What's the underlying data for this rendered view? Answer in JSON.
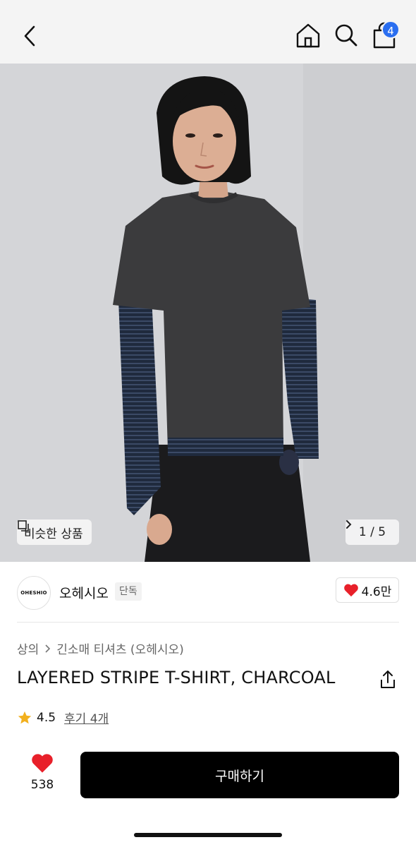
{
  "header": {
    "back_icon": "chevron-left-icon",
    "home_icon": "home-icon",
    "search_icon": "search-icon",
    "cart_icon": "shopping-bag-icon",
    "cart_count": "4",
    "badge_color": "#2a6ef0"
  },
  "hero": {
    "similar_label": "비슷한 상품",
    "similar_icon": "copy-icon",
    "pager": "1 / 5",
    "pager_icon": "chevron-right-icon"
  },
  "brand": {
    "logo_text": "OHESHIO",
    "name": "오헤시오",
    "tag": "단독",
    "likes": "4.6만",
    "heart_color": "#e8202a"
  },
  "breadcrumb": {
    "category": "상의",
    "subcategory": "긴소매 티셔츠 (오헤시오)"
  },
  "product": {
    "title": "LAYERED STRIPE T-SHIRT, CHARCOAL",
    "share_icon": "share-icon",
    "rating": "4.5",
    "reviews": "후기 4개",
    "star_color": "#f2b01e"
  },
  "actions": {
    "wish_count": "538",
    "buy_label": "구매하기"
  }
}
